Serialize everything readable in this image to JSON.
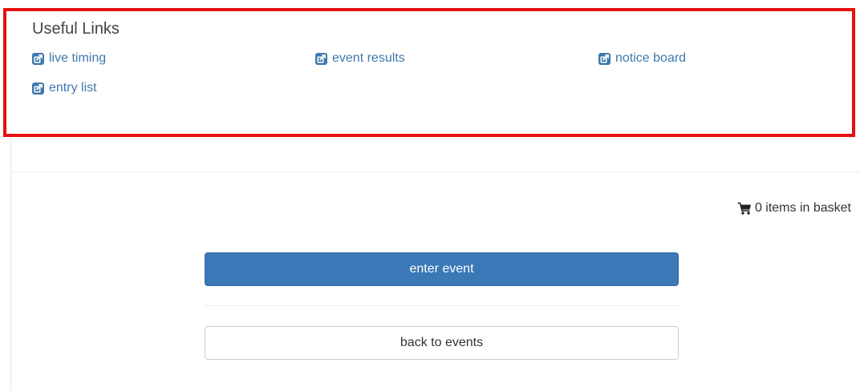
{
  "useful_links": {
    "title": "Useful Links",
    "items": [
      {
        "label": "live timing",
        "icon": "external-link-icon"
      },
      {
        "label": "event results",
        "icon": "external-link-icon"
      },
      {
        "label": "notice board",
        "icon": "external-link-icon"
      },
      {
        "label": "entry list",
        "icon": "external-link-icon"
      }
    ]
  },
  "basket": {
    "label": "0 items in basket",
    "icon": "shopping-cart-icon"
  },
  "actions": {
    "enter_label": "enter event",
    "back_label": "back to events"
  },
  "colors": {
    "link": "#3f78ad",
    "primary_button": "#3a78b7",
    "highlight_border": "#e8100f"
  }
}
